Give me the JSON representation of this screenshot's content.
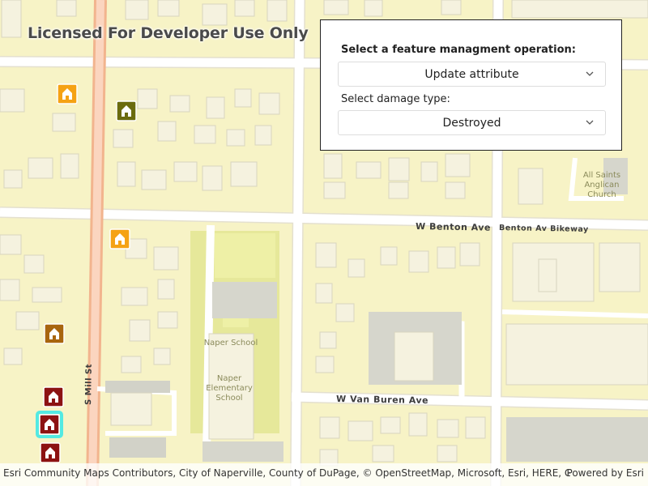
{
  "map": {
    "watermark": "Licensed For Developer Use Only",
    "roads": {
      "w_benton": "W Benton Ave",
      "benton_bikeway": "Benton Av Bikeway",
      "w_van_buren": "W Van Buren Ave",
      "s_mill": "S Mill St"
    },
    "places": {
      "church": [
        "All Saints",
        "Anglican",
        "Church"
      ],
      "school_label": "Naper School",
      "school_building": [
        "Naper",
        "Elementary",
        "School"
      ]
    },
    "markers": [
      {
        "color": "#f5a214",
        "name": "damage-marker"
      },
      {
        "color": "#6b6b0e",
        "name": "damage-marker"
      },
      {
        "color": "#f5a214",
        "name": "damage-marker"
      },
      {
        "color": "#a8650e",
        "name": "damage-marker"
      },
      {
        "color": "#8c1212",
        "name": "damage-marker"
      },
      {
        "color": "#8c1212",
        "name": "damage-marker-selected"
      },
      {
        "color": "#8c1212",
        "name": "damage-marker"
      }
    ],
    "selection_color": "#37e6e6"
  },
  "panel": {
    "operation_label": "Select a feature managment operation:",
    "operation_value": "Update attribute",
    "damage_label": "Select damage type:",
    "damage_value": "Destroyed"
  },
  "attribution": {
    "text": "Esri Community Maps Contributors, City of Naperville, County of DuPage, © OpenStreetMap, Microsoft, Esri, HERE, Garmin, SafeGr...",
    "powered": "Powered by Esri"
  }
}
